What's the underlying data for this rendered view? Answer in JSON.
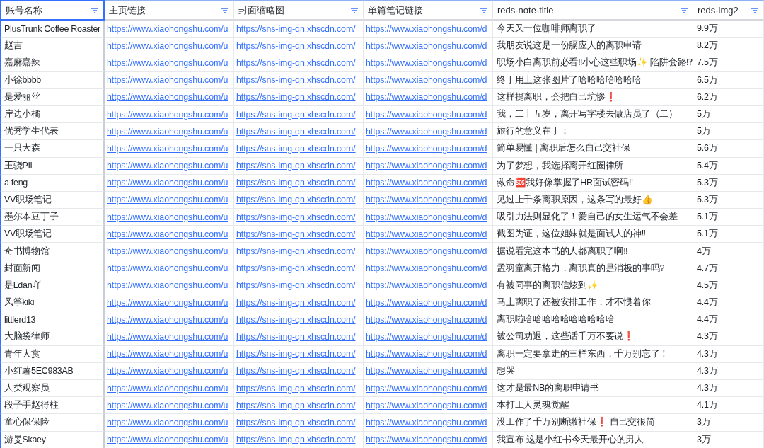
{
  "table": {
    "columns": [
      {
        "label": "账号名称",
        "kind": "text",
        "selected": true
      },
      {
        "label": "主页链接",
        "kind": "link",
        "selected": false
      },
      {
        "label": "封面缩略图",
        "kind": "link",
        "selected": false
      },
      {
        "label": "单篇笔记链接",
        "kind": "link",
        "selected": false
      },
      {
        "label": "reds-note-title",
        "kind": "text",
        "selected": false
      },
      {
        "label": "reds-img2",
        "kind": "text",
        "selected": false
      }
    ],
    "rows": [
      {
        "cells": [
          "PlusTrunk Coffee Roaster",
          "https://www.xiaohongshu.com/u",
          "https://sns-img-qn.xhscdn.com/",
          "https://www.xiaohongshu.com/d",
          "今天又一位咖啡师离职了",
          "9.9万"
        ]
      },
      {
        "cells": [
          "赵吉",
          "https://www.xiaohongshu.com/u",
          "https://sns-img-qn.xhscdn.com/",
          "https://www.xiaohongshu.com/d",
          "我朋友说这是一份膈应人的离职申请",
          "8.2万"
        ]
      },
      {
        "cells": [
          "嘉麻嘉辣",
          "https://www.xiaohongshu.com/u",
          "https://sns-img-qn.xhscdn.com/",
          "https://www.xiaohongshu.com/d",
          "职场小白离职前必看‼小心这些职场✨ 陷阱套路⁉",
          "7.5万"
        ]
      },
      {
        "cells": [
          "小徐bbbb",
          "https://www.xiaohongshu.com/u",
          "https://sns-img-qn.xhscdn.com/",
          "https://www.xiaohongshu.com/d",
          "终于用上这张图片了哈哈哈哈哈哈哈",
          "6.5万"
        ]
      },
      {
        "cells": [
          "是爱丽丝",
          "https://www.xiaohongshu.com/u",
          "https://sns-img-qn.xhscdn.com/",
          "https://www.xiaohongshu.com/d",
          "这样提离职，会把自己坑惨❗",
          "6.2万"
        ]
      },
      {
        "cells": [
          "岸边小橘",
          "https://www.xiaohongshu.com/u",
          "https://sns-img-qn.xhscdn.com/",
          "https://www.xiaohongshu.com/d",
          "我，二十五岁，离开写字楼去做店员了（二）",
          "5万"
        ]
      },
      {
        "cells": [
          "优秀学生代表",
          "https://www.xiaohongshu.com/u",
          "https://sns-img-qn.xhscdn.com/",
          "https://www.xiaohongshu.com/d",
          "旅行的意义在于：",
          "5万"
        ]
      },
      {
        "cells": [
          "一只大森",
          "https://www.xiaohongshu.com/u",
          "https://sns-img-qn.xhscdn.com/",
          "https://www.xiaohongshu.com/d",
          "简单易懂 | 离职后怎么自己交社保",
          "5.6万"
        ]
      },
      {
        "cells": [
          "王骁PIL",
          "https://www.xiaohongshu.com/u",
          "https://sns-img-qn.xhscdn.com/",
          "https://www.xiaohongshu.com/d",
          "为了梦想，我选择离开红圈律所",
          "5.4万"
        ]
      },
      {
        "cells": [
          "a feng",
          "https://www.xiaohongshu.com/u",
          "https://sns-img-qn.xhscdn.com/",
          "https://www.xiaohongshu.com/d",
          "救命🆘我好像掌握了HR面试密码‼",
          "5.3万"
        ]
      },
      {
        "cells": [
          "VV职场笔记",
          "https://www.xiaohongshu.com/u",
          "https://sns-img-qn.xhscdn.com/",
          "https://www.xiaohongshu.com/d",
          "见过上千条离职原因，这条写的最好👍",
          "5.3万"
        ]
      },
      {
        "cells": [
          "墨尔本豆丁子",
          "https://www.xiaohongshu.com/u",
          "https://sns-img-qn.xhscdn.com/",
          "https://www.xiaohongshu.com/d",
          "吸引力法则显化了！爱自己的女生运气不会差",
          "5.1万"
        ]
      },
      {
        "cells": [
          "VV职场笔记",
          "https://www.xiaohongshu.com/u",
          "https://sns-img-qn.xhscdn.com/",
          "https://www.xiaohongshu.com/d",
          "截图为证，这位姐妹就是面试人的神‼",
          "5.1万"
        ]
      },
      {
        "cells": [
          "奇书博物馆",
          "https://www.xiaohongshu.com/u",
          "https://sns-img-qn.xhscdn.com/",
          "https://www.xiaohongshu.com/d",
          "据说看完这本书的人都离职了啊‼",
          "4万"
        ]
      },
      {
        "cells": [
          "封面新闻",
          "https://www.xiaohongshu.com/u",
          "https://sns-img-qn.xhscdn.com/",
          "https://www.xiaohongshu.com/d",
          "孟羽童离开格力，离职真的是消极的事吗?",
          "4.7万"
        ]
      },
      {
        "cells": [
          "是Ldan吖",
          "https://www.xiaohongshu.com/u",
          "https://sns-img-qn.xhscdn.com/",
          "https://www.xiaohongshu.com/d",
          "有被同事的离职信炫到✨",
          "4.5万"
        ]
      },
      {
        "cells": [
          "风筝kiki",
          "https://www.xiaohongshu.com/u",
          "https://sns-img-qn.xhscdn.com/",
          "https://www.xiaohongshu.com/d",
          "马上离职了还被安排工作，才不惯着你",
          "4.4万"
        ]
      },
      {
        "cells": [
          "littlerd13",
          "https://www.xiaohongshu.com/u",
          "https://sns-img-qn.xhscdn.com/",
          "https://www.xiaohongshu.com/d",
          "离职啦哈哈哈哈哈哈哈哈哈哈",
          "4.4万"
        ]
      },
      {
        "cells": [
          "大脑袋律师",
          "https://www.xiaohongshu.com/u",
          "https://sns-img-qn.xhscdn.com/",
          "https://www.xiaohongshu.com/d",
          "被公司劝退，这些话千万不要说❗",
          "4.3万"
        ]
      },
      {
        "cells": [
          "青年大赏",
          "https://www.xiaohongshu.com/u",
          "https://sns-img-qn.xhscdn.com/",
          "https://www.xiaohongshu.com/d",
          "离职一定要拿走的三样东西，千万别忘了！",
          "4.3万"
        ]
      },
      {
        "cells": [
          "小红薯5EC983AB",
          "https://www.xiaohongshu.com/u",
          "https://sns-img-qn.xhscdn.com/",
          "https://www.xiaohongshu.com/d",
          "想哭",
          "4.3万"
        ]
      },
      {
        "cells": [
          "人类观察员",
          "https://www.xiaohongshu.com/u",
          "https://sns-img-qn.xhscdn.com/",
          "https://www.xiaohongshu.com/d",
          "这才是最NB的离职申请书",
          "4.3万"
        ]
      },
      {
        "cells": [
          "段子手赵得柱",
          "https://www.xiaohongshu.com/u",
          "https://sns-img-qn.xhscdn.com/",
          "https://www.xiaohongshu.com/d",
          "本打工人灵魂觉醒",
          "4.1万"
        ]
      },
      {
        "cells": [
          "童心保保险",
          "https://www.xiaohongshu.com/u",
          "https://sns-img-qn.xhscdn.com/",
          "https://www.xiaohongshu.com/d",
          "没工作了千万别断缴社保❗ 自己交很简",
          "3万"
        ]
      },
      {
        "cells": [
          "游旻Skaey",
          "https://www.xiaohongshu.com/u",
          "https://sns-img-qn.xhscdn.com/",
          "https://www.xiaohongshu.com/d",
          "我宣布 这是小红书今天最开心的男人",
          "3万"
        ]
      }
    ]
  }
}
